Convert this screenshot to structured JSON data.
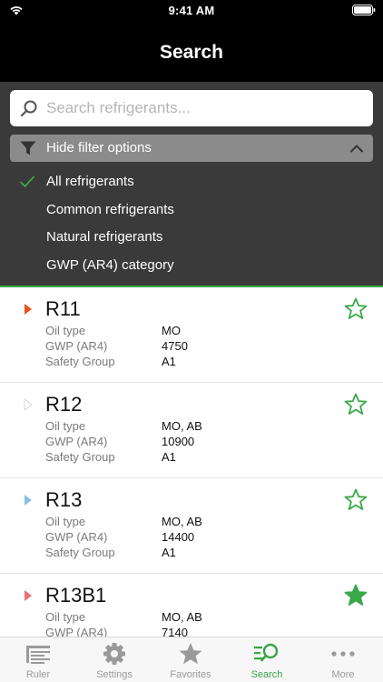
{
  "status_bar": {
    "time": "9:41 AM"
  },
  "header": {
    "title": "Search"
  },
  "search": {
    "placeholder": "Search refrigerants..."
  },
  "filter": {
    "toggle_label": "Hide filter options",
    "options": [
      {
        "label": "All refrigerants",
        "selected": true
      },
      {
        "label": "Common refrigerants",
        "selected": false
      },
      {
        "label": "Natural refrigerants",
        "selected": false
      },
      {
        "label": "GWP (AR4) category",
        "selected": false
      }
    ]
  },
  "colors": {
    "accent_green": "#3aa84a",
    "panel_bg": "#3a3a3a"
  },
  "refrigerants": [
    {
      "name": "R11",
      "marker_color": "#e8521d",
      "favorite": false,
      "fields": [
        {
          "key": "Oil type",
          "value": "MO"
        },
        {
          "key": "GWP (AR4)",
          "value": "4750"
        },
        {
          "key": "Safety Group",
          "value": "A1"
        }
      ]
    },
    {
      "name": "R12",
      "marker_color": "#ffffff",
      "favorite": false,
      "fields": [
        {
          "key": "Oil type",
          "value": "MO, AB"
        },
        {
          "key": "GWP (AR4)",
          "value": "10900"
        },
        {
          "key": "Safety Group",
          "value": "A1"
        }
      ]
    },
    {
      "name": "R13",
      "marker_color": "#86c2dd",
      "favorite": false,
      "fields": [
        {
          "key": "Oil type",
          "value": "MO, AB"
        },
        {
          "key": "GWP (AR4)",
          "value": "14400"
        },
        {
          "key": "Safety Group",
          "value": "A1"
        }
      ]
    },
    {
      "name": "R13B1",
      "marker_color": "#e8717a",
      "favorite": true,
      "fields": [
        {
          "key": "Oil type",
          "value": "MO, AB"
        },
        {
          "key": "GWP (AR4)",
          "value": "7140"
        }
      ]
    }
  ],
  "tabbar": {
    "tabs": [
      {
        "label": "Ruler",
        "icon": "ruler-icon",
        "active": false
      },
      {
        "label": "Settings",
        "icon": "gear-icon",
        "active": false
      },
      {
        "label": "Favorites",
        "icon": "star-icon",
        "active": false
      },
      {
        "label": "Search",
        "icon": "search-list-icon",
        "active": true
      },
      {
        "label": "More",
        "icon": "more-dots-icon",
        "active": false
      }
    ]
  }
}
